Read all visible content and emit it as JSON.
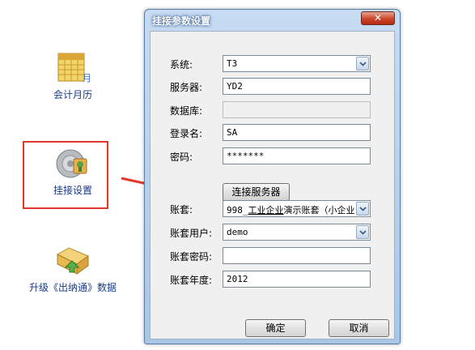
{
  "launcher": {
    "calendar_label": "会计月历",
    "mount_label": "挂接设置",
    "upgrade_label": "升级《出纳通》数据"
  },
  "dialog": {
    "title": "挂接参数设置",
    "close_symbol": "✕",
    "fields": {
      "system": {
        "label": "系统:",
        "value": "T3"
      },
      "server": {
        "label": "服务器:",
        "value": "YD2"
      },
      "database": {
        "label": "数据库:",
        "value": ""
      },
      "login": {
        "label": "登录名:",
        "value": "SA"
      },
      "password": {
        "label": "密码:",
        "value": "*******"
      },
      "account": {
        "label": "账套:",
        "value_prefix": "998_",
        "value_underlined": "工业企业",
        "value_suffix": "演示账套（小企业",
        "value_tail": "·"
      },
      "account_user": {
        "label": "账套用户:",
        "value": "demo"
      },
      "account_password": {
        "label": "账套密码:",
        "value": ""
      },
      "account_year": {
        "label": "账套年度:",
        "value": "2012"
      }
    },
    "connect_label": "连接服务器",
    "ok_label": "确定",
    "cancel_label": "取消"
  },
  "colors": {
    "highlight_box": "#e0392b",
    "arrow": "#e0392b",
    "window_frame": "#a9c6e6",
    "close_button": "#c9452b"
  },
  "icons": [
    "calendar-icon",
    "gear-disc-icon",
    "folder-upgrade-icon",
    "close-icon",
    "chevron-down-icon",
    "arrow-annotation-icon"
  ]
}
